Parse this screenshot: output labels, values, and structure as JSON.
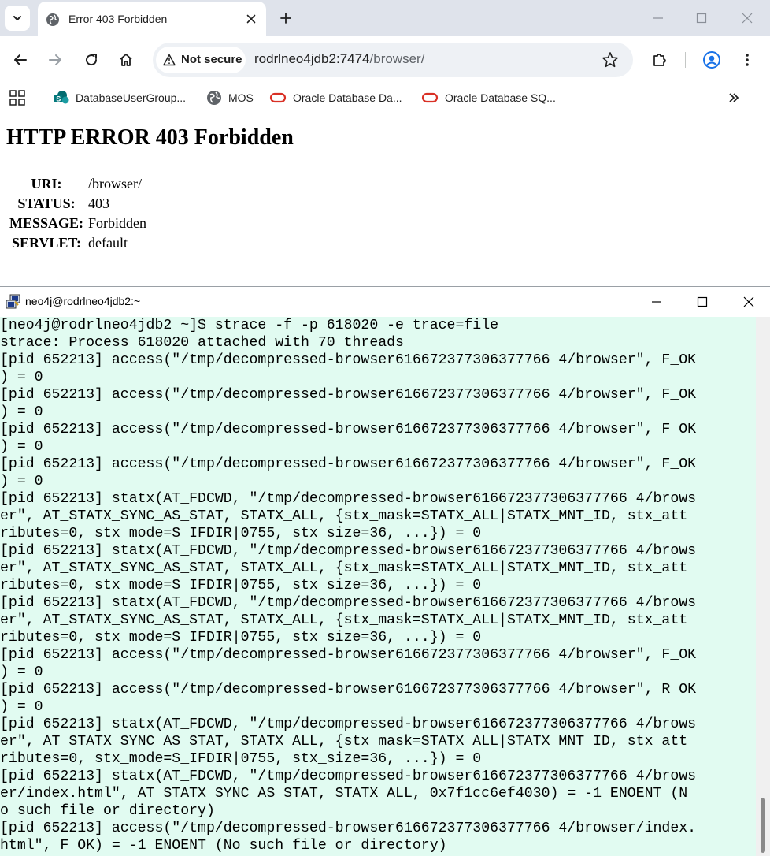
{
  "browser": {
    "tab": {
      "title": "Error 403 Forbidden",
      "icon": "globe-icon"
    },
    "omnibox": {
      "security_label": "Not secure",
      "url_host": "rodrlneo4jdb2:7474",
      "url_path": "/browser/"
    },
    "bookmarks": [
      {
        "label": "DatabaseUserGroup...",
        "icon": "sharepoint-icon"
      },
      {
        "label": "MOS",
        "icon": "globe-icon"
      },
      {
        "label": "Oracle Database Da...",
        "icon": "oracle-icon"
      },
      {
        "label": "Oracle Database SQ...",
        "icon": "oracle-icon"
      }
    ],
    "colors": {
      "tabstrip": "#dfe3eb",
      "omnibox": "#eef1f5",
      "accent": "#1a73e8",
      "oracle": "#d93025"
    }
  },
  "page": {
    "heading": "HTTP ERROR 403 Forbidden",
    "rows": [
      {
        "label": "URI:",
        "value": "/browser/"
      },
      {
        "label": "STATUS:",
        "value": "403"
      },
      {
        "label": "MESSAGE:",
        "value": "Forbidden"
      },
      {
        "label": "SERVLET:",
        "value": "default"
      }
    ]
  },
  "terminal": {
    "title": "neo4j@rodrlneo4jdb2:~",
    "background": "#e1fbf1",
    "lines": [
      "[neo4j@rodrlneo4jdb2 ~]$ strace -f -p 618020 -e trace=file",
      "strace: Process 618020 attached with 70 threads",
      "[pid 652213] access(\"/tmp/decompressed-browser616672377306377766 4/browser\", F_OK",
      ") = 0",
      "[pid 652213] access(\"/tmp/decompressed-browser616672377306377766 4/browser\", F_OK",
      ") = 0",
      "[pid 652213] access(\"/tmp/decompressed-browser616672377306377766 4/browser\", F_OK",
      ") = 0",
      "[pid 652213] access(\"/tmp/decompressed-browser616672377306377766 4/browser\", F_OK",
      ") = 0",
      "[pid 652213] statx(AT_FDCWD, \"/tmp/decompressed-browser616672377306377766 4/brows",
      "er\", AT_STATX_SYNC_AS_STAT, STATX_ALL, {stx_mask=STATX_ALL|STATX_MNT_ID, stx_att",
      "ributes=0, stx_mode=S_IFDIR|0755, stx_size=36, ...}) = 0",
      "[pid 652213] statx(AT_FDCWD, \"/tmp/decompressed-browser616672377306377766 4/brows",
      "er\", AT_STATX_SYNC_AS_STAT, STATX_ALL, {stx_mask=STATX_ALL|STATX_MNT_ID, stx_att",
      "ributes=0, stx_mode=S_IFDIR|0755, stx_size=36, ...}) = 0",
      "[pid 652213] statx(AT_FDCWD, \"/tmp/decompressed-browser616672377306377766 4/brows",
      "er\", AT_STATX_SYNC_AS_STAT, STATX_ALL, {stx_mask=STATX_ALL|STATX_MNT_ID, stx_att",
      "ributes=0, stx_mode=S_IFDIR|0755, stx_size=36, ...}) = 0",
      "[pid 652213] access(\"/tmp/decompressed-browser616672377306377766 4/browser\", F_OK",
      ") = 0",
      "[pid 652213] access(\"/tmp/decompressed-browser616672377306377766 4/browser\", R_OK",
      ") = 0",
      "[pid 652213] statx(AT_FDCWD, \"/tmp/decompressed-browser616672377306377766 4/brows",
      "er\", AT_STATX_SYNC_AS_STAT, STATX_ALL, {stx_mask=STATX_ALL|STATX_MNT_ID, stx_att",
      "ributes=0, stx_mode=S_IFDIR|0755, stx_size=36, ...}) = 0",
      "[pid 652213] statx(AT_FDCWD, \"/tmp/decompressed-browser616672377306377766 4/brows",
      "er/index.html\", AT_STATX_SYNC_AS_STAT, STATX_ALL, 0x7f1cc6ef4030) = -1 ENOENT (N",
      "o such file or directory)",
      "[pid 652213] access(\"/tmp/decompressed-browser616672377306377766 4/browser/index.",
      "html\", F_OK) = -1 ENOENT (No such file or directory)"
    ]
  }
}
